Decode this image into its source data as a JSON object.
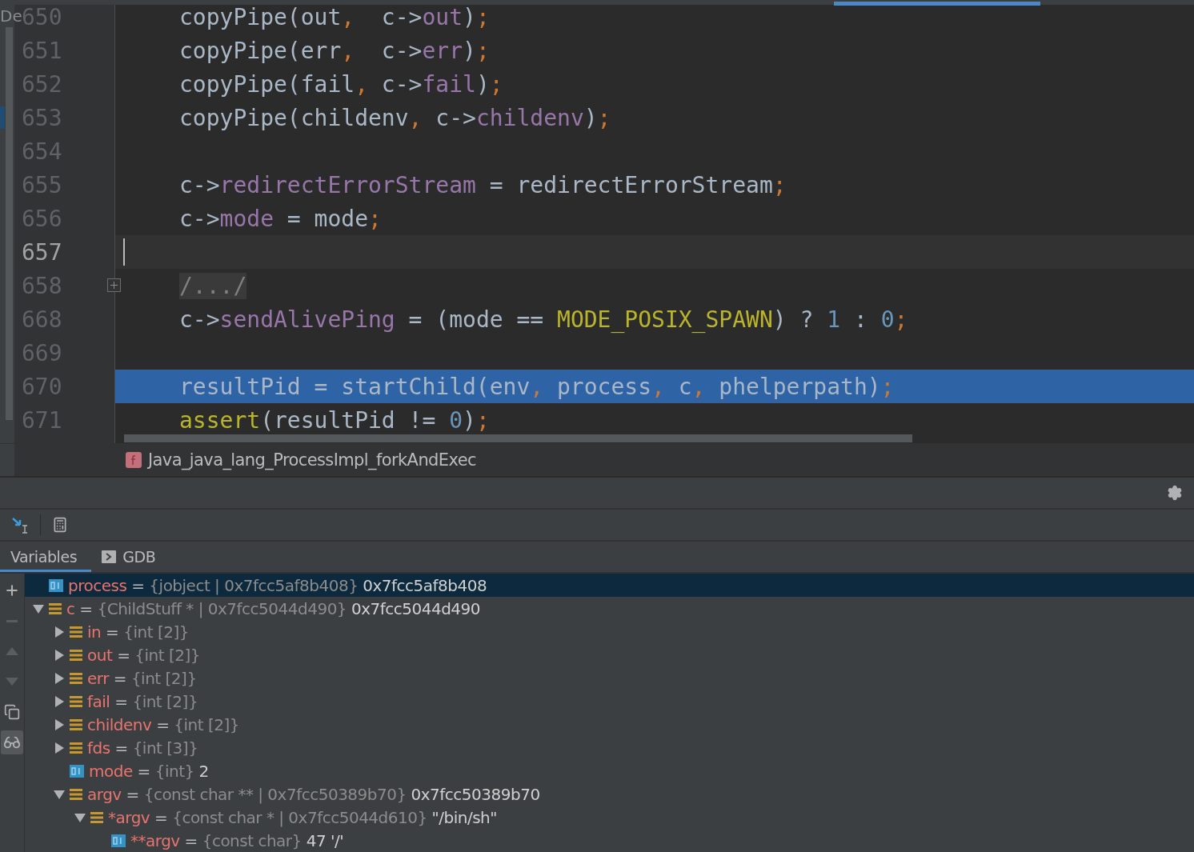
{
  "side_label": "De",
  "editor": {
    "lines": [
      {
        "number": "650",
        "current": false,
        "selected": false,
        "bookmarked": false,
        "foldable": false,
        "tokens": [
          {
            "kind": "plain",
            "text": "copyPipe(out"
          },
          {
            "kind": "punct",
            "text": ","
          },
          {
            "kind": "plain",
            "text": "  c->"
          },
          {
            "kind": "field",
            "text": "out"
          },
          {
            "kind": "plain",
            "text": ")"
          },
          {
            "kind": "punct",
            "text": ";"
          }
        ]
      },
      {
        "number": "651",
        "current": false,
        "selected": false,
        "bookmarked": false,
        "foldable": false,
        "tokens": [
          {
            "kind": "plain",
            "text": "copyPipe(err"
          },
          {
            "kind": "punct",
            "text": ","
          },
          {
            "kind": "plain",
            "text": "  c->"
          },
          {
            "kind": "field",
            "text": "err"
          },
          {
            "kind": "plain",
            "text": ")"
          },
          {
            "kind": "punct",
            "text": ";"
          }
        ]
      },
      {
        "number": "652",
        "current": false,
        "selected": false,
        "bookmarked": false,
        "foldable": false,
        "tokens": [
          {
            "kind": "plain",
            "text": "copyPipe(fail"
          },
          {
            "kind": "punct",
            "text": ","
          },
          {
            "kind": "plain",
            "text": " c->"
          },
          {
            "kind": "field",
            "text": "fail"
          },
          {
            "kind": "plain",
            "text": ")"
          },
          {
            "kind": "punct",
            "text": ";"
          }
        ]
      },
      {
        "number": "653",
        "current": false,
        "selected": false,
        "bookmarked": true,
        "foldable": false,
        "tokens": [
          {
            "kind": "plain",
            "text": "copyPipe(childenv"
          },
          {
            "kind": "punct",
            "text": ","
          },
          {
            "kind": "plain",
            "text": " c->"
          },
          {
            "kind": "field",
            "text": "childenv"
          },
          {
            "kind": "plain",
            "text": ")"
          },
          {
            "kind": "punct",
            "text": ";"
          }
        ]
      },
      {
        "number": "654",
        "current": false,
        "selected": false,
        "bookmarked": false,
        "foldable": false
      },
      {
        "number": "655",
        "current": false,
        "selected": false,
        "bookmarked": false,
        "foldable": false,
        "tokens": [
          {
            "kind": "plain",
            "text": "c->"
          },
          {
            "kind": "field",
            "text": "redirectErrorStream"
          },
          {
            "kind": "plain",
            "text": " = redirectErrorStream"
          },
          {
            "kind": "punct",
            "text": ";"
          }
        ]
      },
      {
        "number": "656",
        "current": false,
        "selected": false,
        "bookmarked": false,
        "foldable": false,
        "tokens": [
          {
            "kind": "plain",
            "text": "c->"
          },
          {
            "kind": "field",
            "text": "mode"
          },
          {
            "kind": "plain",
            "text": " = mode"
          },
          {
            "kind": "punct",
            "text": ";"
          }
        ]
      },
      {
        "number": "657",
        "current": true,
        "selected": false,
        "bookmarked": false,
        "foldable": false
      },
      {
        "number": "658",
        "current": false,
        "selected": false,
        "bookmarked": false,
        "foldable": true,
        "tokens": [
          {
            "kind": "fold",
            "text": "/.../"
          }
        ]
      },
      {
        "number": "668",
        "current": false,
        "selected": false,
        "bookmarked": false,
        "foldable": false,
        "tokens": [
          {
            "kind": "plain",
            "text": "c->"
          },
          {
            "kind": "field",
            "text": "sendAlivePing"
          },
          {
            "kind": "plain",
            "text": " = (mode == "
          },
          {
            "kind": "macro",
            "text": "MODE_POSIX_SPAWN"
          },
          {
            "kind": "plain",
            "text": ") ? "
          },
          {
            "kind": "number",
            "text": "1"
          },
          {
            "kind": "plain",
            "text": " : "
          },
          {
            "kind": "number",
            "text": "0"
          },
          {
            "kind": "punct",
            "text": ";"
          }
        ]
      },
      {
        "number": "669",
        "current": false,
        "selected": false,
        "bookmarked": false,
        "foldable": false
      },
      {
        "number": "670",
        "current": false,
        "selected": true,
        "bookmarked": false,
        "foldable": false,
        "tokens": [
          {
            "kind": "plain",
            "text": "resultPid = startChild(env"
          },
          {
            "kind": "punct",
            "text": ","
          },
          {
            "kind": "plain",
            "text": " process"
          },
          {
            "kind": "punct",
            "text": ","
          },
          {
            "kind": "plain",
            "text": " c"
          },
          {
            "kind": "punct",
            "text": ","
          },
          {
            "kind": "plain",
            "text": " phelperpath)"
          },
          {
            "kind": "punct",
            "text": ";"
          }
        ]
      },
      {
        "number": "671",
        "current": false,
        "selected": false,
        "bookmarked": false,
        "foldable": false,
        "tokens": [
          {
            "kind": "call",
            "text": "assert"
          },
          {
            "kind": "plain",
            "text": "(resultPid != "
          },
          {
            "kind": "number",
            "text": "0"
          },
          {
            "kind": "plain",
            "text": ")"
          },
          {
            "kind": "punct",
            "text": ";"
          }
        ]
      }
    ]
  },
  "breadcrumb": {
    "function": "Java_java_lang_ProcessImpl_forkAndExec"
  },
  "debug_tabs": [
    {
      "label": "Variables",
      "selected": true
    },
    {
      "label": "GDB",
      "selected": false
    }
  ],
  "tree_tools": [
    {
      "kind": "add",
      "disabled": false,
      "selected": false
    },
    {
      "kind": "remove",
      "disabled": true,
      "selected": false
    },
    {
      "kind": "up",
      "disabled": true,
      "selected": false
    },
    {
      "kind": "down",
      "disabled": true,
      "selected": false
    },
    {
      "kind": "copy",
      "disabled": false,
      "selected": false
    },
    {
      "kind": "watches",
      "disabled": false,
      "selected": true
    }
  ],
  "variables": [
    {
      "name": "process",
      "sign": "=",
      "type": "{jobject | 0x7fcc5af8b408}",
      "value": "0x7fcc5af8b408",
      "kind": "primitive",
      "selected": true
    },
    {
      "name": "c",
      "sign": "=",
      "type": "{ChildStuff * | 0x7fcc5044d490}",
      "value": "0x7fcc5044d490",
      "kind": "struct",
      "selected": false,
      "expanded": true,
      "children": [
        {
          "name": "in",
          "sign": "=",
          "type": "{int [2]}",
          "kind": "struct",
          "selected": false,
          "expanded": false
        },
        {
          "name": "out",
          "sign": "=",
          "type": "{int [2]}",
          "kind": "struct",
          "selected": false,
          "expanded": false
        },
        {
          "name": "err",
          "sign": "=",
          "type": "{int [2]}",
          "kind": "struct",
          "selected": false,
          "expanded": false
        },
        {
          "name": "fail",
          "sign": "=",
          "type": "{int [2]}",
          "kind": "struct",
          "selected": false,
          "expanded": false
        },
        {
          "name": "childenv",
          "sign": "=",
          "type": "{int [2]}",
          "kind": "struct",
          "selected": false,
          "expanded": false
        },
        {
          "name": "fds",
          "sign": "=",
          "type": "{int [3]}",
          "kind": "struct",
          "selected": false,
          "expanded": false
        },
        {
          "name": "mode",
          "sign": "=",
          "type": "{int}",
          "value": "2",
          "kind": "primitive",
          "selected": false
        },
        {
          "name": "argv",
          "sign": "=",
          "type": "{const char ** | 0x7fcc50389b70}",
          "value": "0x7fcc50389b70",
          "kind": "struct",
          "selected": false,
          "expanded": true,
          "children": [
            {
              "name": "*argv",
              "sign": "=",
              "type": "{const char * | 0x7fcc5044d610}",
              "value": "\"/bin/sh\"",
              "kind": "struct",
              "selected": false,
              "expanded": true,
              "children": [
                {
                  "name": "**argv",
                  "sign": "=",
                  "type": "{const char}",
                  "value": "47 '/'",
                  "kind": "primitive",
                  "selected": false
                }
              ]
            }
          ]
        }
      ]
    }
  ]
}
